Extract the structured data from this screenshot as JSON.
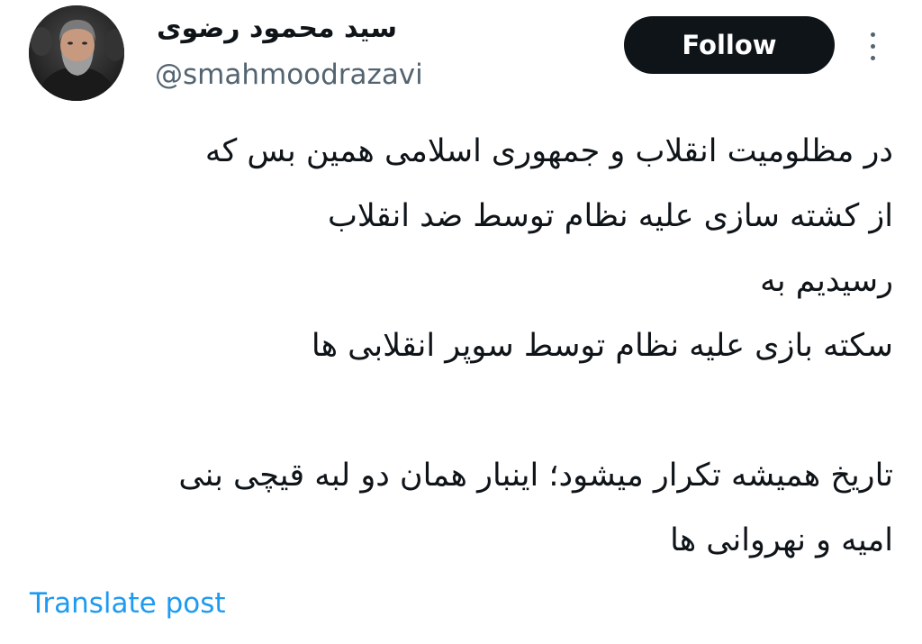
{
  "author": {
    "display_name": "سید محمود رضوی",
    "handle": "@smahmoodrazavi",
    "avatar_icon": "profile-photo"
  },
  "actions": {
    "follow_label": "Follow",
    "more_icon": "more-vertical-icon"
  },
  "tweet": {
    "lines": [
      "در مظلومیت انقلاب و جمهوری اسلامی همین بس که",
      "از کشته سازی علیه نظام توسط ضد انقلاب",
      "رسیدیم به",
      "سکته بازی علیه نظام توسط سوپر انقلابی ها",
      "",
      "تاریخ همیشه تکرار میشود؛ اینبار همان دو لبه قیچی بنی",
      "امیه و نهروانی ها"
    ]
  },
  "footer": {
    "translate_label": "Translate post"
  },
  "colors": {
    "text": "#0f1419",
    "secondary": "#536471",
    "link": "#1d9bf0",
    "button_bg": "#0f1419",
    "button_text": "#ffffff"
  }
}
